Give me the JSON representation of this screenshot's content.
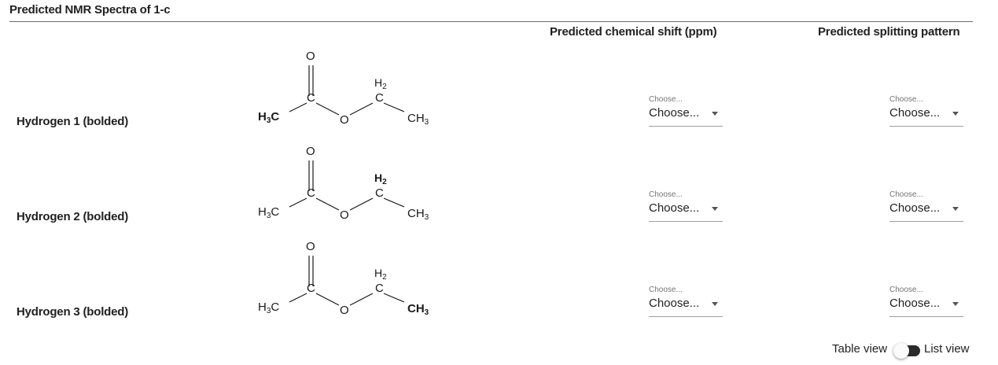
{
  "page": {
    "title": "Predicted NMR Spectra of 1-c"
  },
  "columns": {
    "shift": "Predicted chemical shift (ppm)",
    "splitting": "Predicted splitting pattern"
  },
  "rows": [
    {
      "label": "Hydrogen 1 (bolded)",
      "bold_group": "H3C-right",
      "shift": {
        "label": "Choose...",
        "value": "Choose..."
      },
      "splitting": {
        "label": "Choose...",
        "value": "Choose..."
      }
    },
    {
      "label": "Hydrogen 2 (bolded)",
      "bold_group": "CH2",
      "shift": {
        "label": "Choose...",
        "value": "Choose..."
      },
      "splitting": {
        "label": "Choose...",
        "value": "Choose..."
      }
    },
    {
      "label": "Hydrogen 3 (bolded)",
      "bold_group": "CH3-right",
      "shift": {
        "label": "Choose...",
        "value": "Choose..."
      },
      "splitting": {
        "label": "Choose...",
        "value": "Choose..."
      }
    }
  ],
  "molecule": {
    "atom_O_carbonyl": "O",
    "atom_C_carbonyl": "C",
    "atom_O_ester": "O",
    "atom_C_methylene": "C",
    "left_methyl": "H3C",
    "methylene_H": "H2",
    "right_methyl": "CH3"
  },
  "view_toggle": {
    "left_label": "Table view",
    "right_label": "List view",
    "state": "list"
  },
  "colors": {
    "text": "#212121",
    "muted": "#757575",
    "underline": "#9e9e9e",
    "toggle_track": "#2b2b2b"
  }
}
